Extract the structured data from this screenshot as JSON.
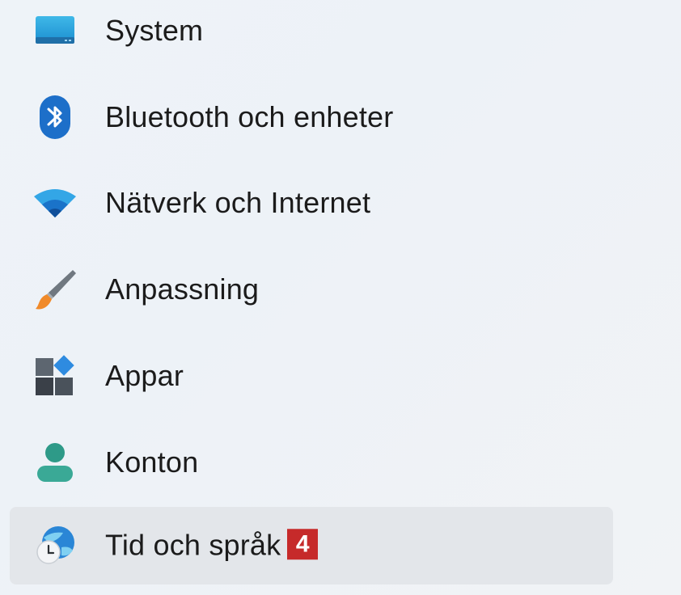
{
  "nav": {
    "items": [
      {
        "label": "System",
        "icon": "monitor-icon"
      },
      {
        "label": "Bluetooth och enheter",
        "icon": "bluetooth-icon"
      },
      {
        "label": "Nätverk och Internet",
        "icon": "wifi-icon"
      },
      {
        "label": "Anpassning",
        "icon": "paintbrush-icon"
      },
      {
        "label": "Appar",
        "icon": "apps-icon"
      },
      {
        "label": "Konton",
        "icon": "person-icon"
      },
      {
        "label": "Tid och språk",
        "icon": "globe-clock-icon",
        "selected": true,
        "badge": "4"
      }
    ]
  },
  "colors": {
    "selected_bg": "#e3e6ea",
    "badge_bg": "#c62a2a",
    "accent_blue": "#1f6fd1",
    "teal": "#2e9a88"
  }
}
